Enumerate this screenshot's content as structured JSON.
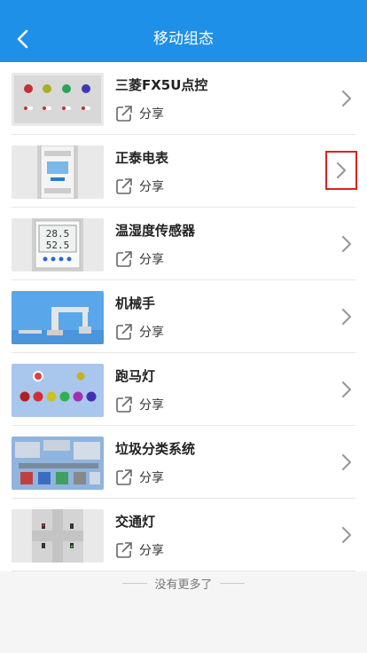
{
  "header": {
    "title": "移动组态",
    "back_icon": "chevron-left-icon",
    "color": "#1E90E8"
  },
  "items": [
    {
      "title": "三菱FX5U点控",
      "share_label": "分享",
      "thumb": "mitsubishi-plc",
      "share_icon": "share-icon"
    },
    {
      "title": "正泰电表",
      "share_label": "分享",
      "thumb": "power-meter",
      "share_icon": "share-icon",
      "highlighted": true
    },
    {
      "title": "温湿度传感器",
      "share_label": "分享",
      "thumb": "thermo-hygrometer",
      "share_icon": "share-icon"
    },
    {
      "title": "机械手",
      "share_label": "分享",
      "thumb": "robot-arm",
      "share_icon": "share-icon"
    },
    {
      "title": "跑马灯",
      "share_label": "分享",
      "thumb": "marquee-lights",
      "share_icon": "share-icon"
    },
    {
      "title": "垃圾分类系统",
      "share_label": "分享",
      "thumb": "waste-sorting",
      "share_icon": "share-icon"
    },
    {
      "title": "交通灯",
      "share_label": "分享",
      "thumb": "traffic-light",
      "share_icon": "share-icon"
    }
  ],
  "thumb_readings": {
    "temperature": "28.5",
    "humidity": "52.5"
  },
  "footer": {
    "text": "没有更多了"
  },
  "colors": {
    "accent": "#1E90E8",
    "highlight_box": "#e02020"
  }
}
